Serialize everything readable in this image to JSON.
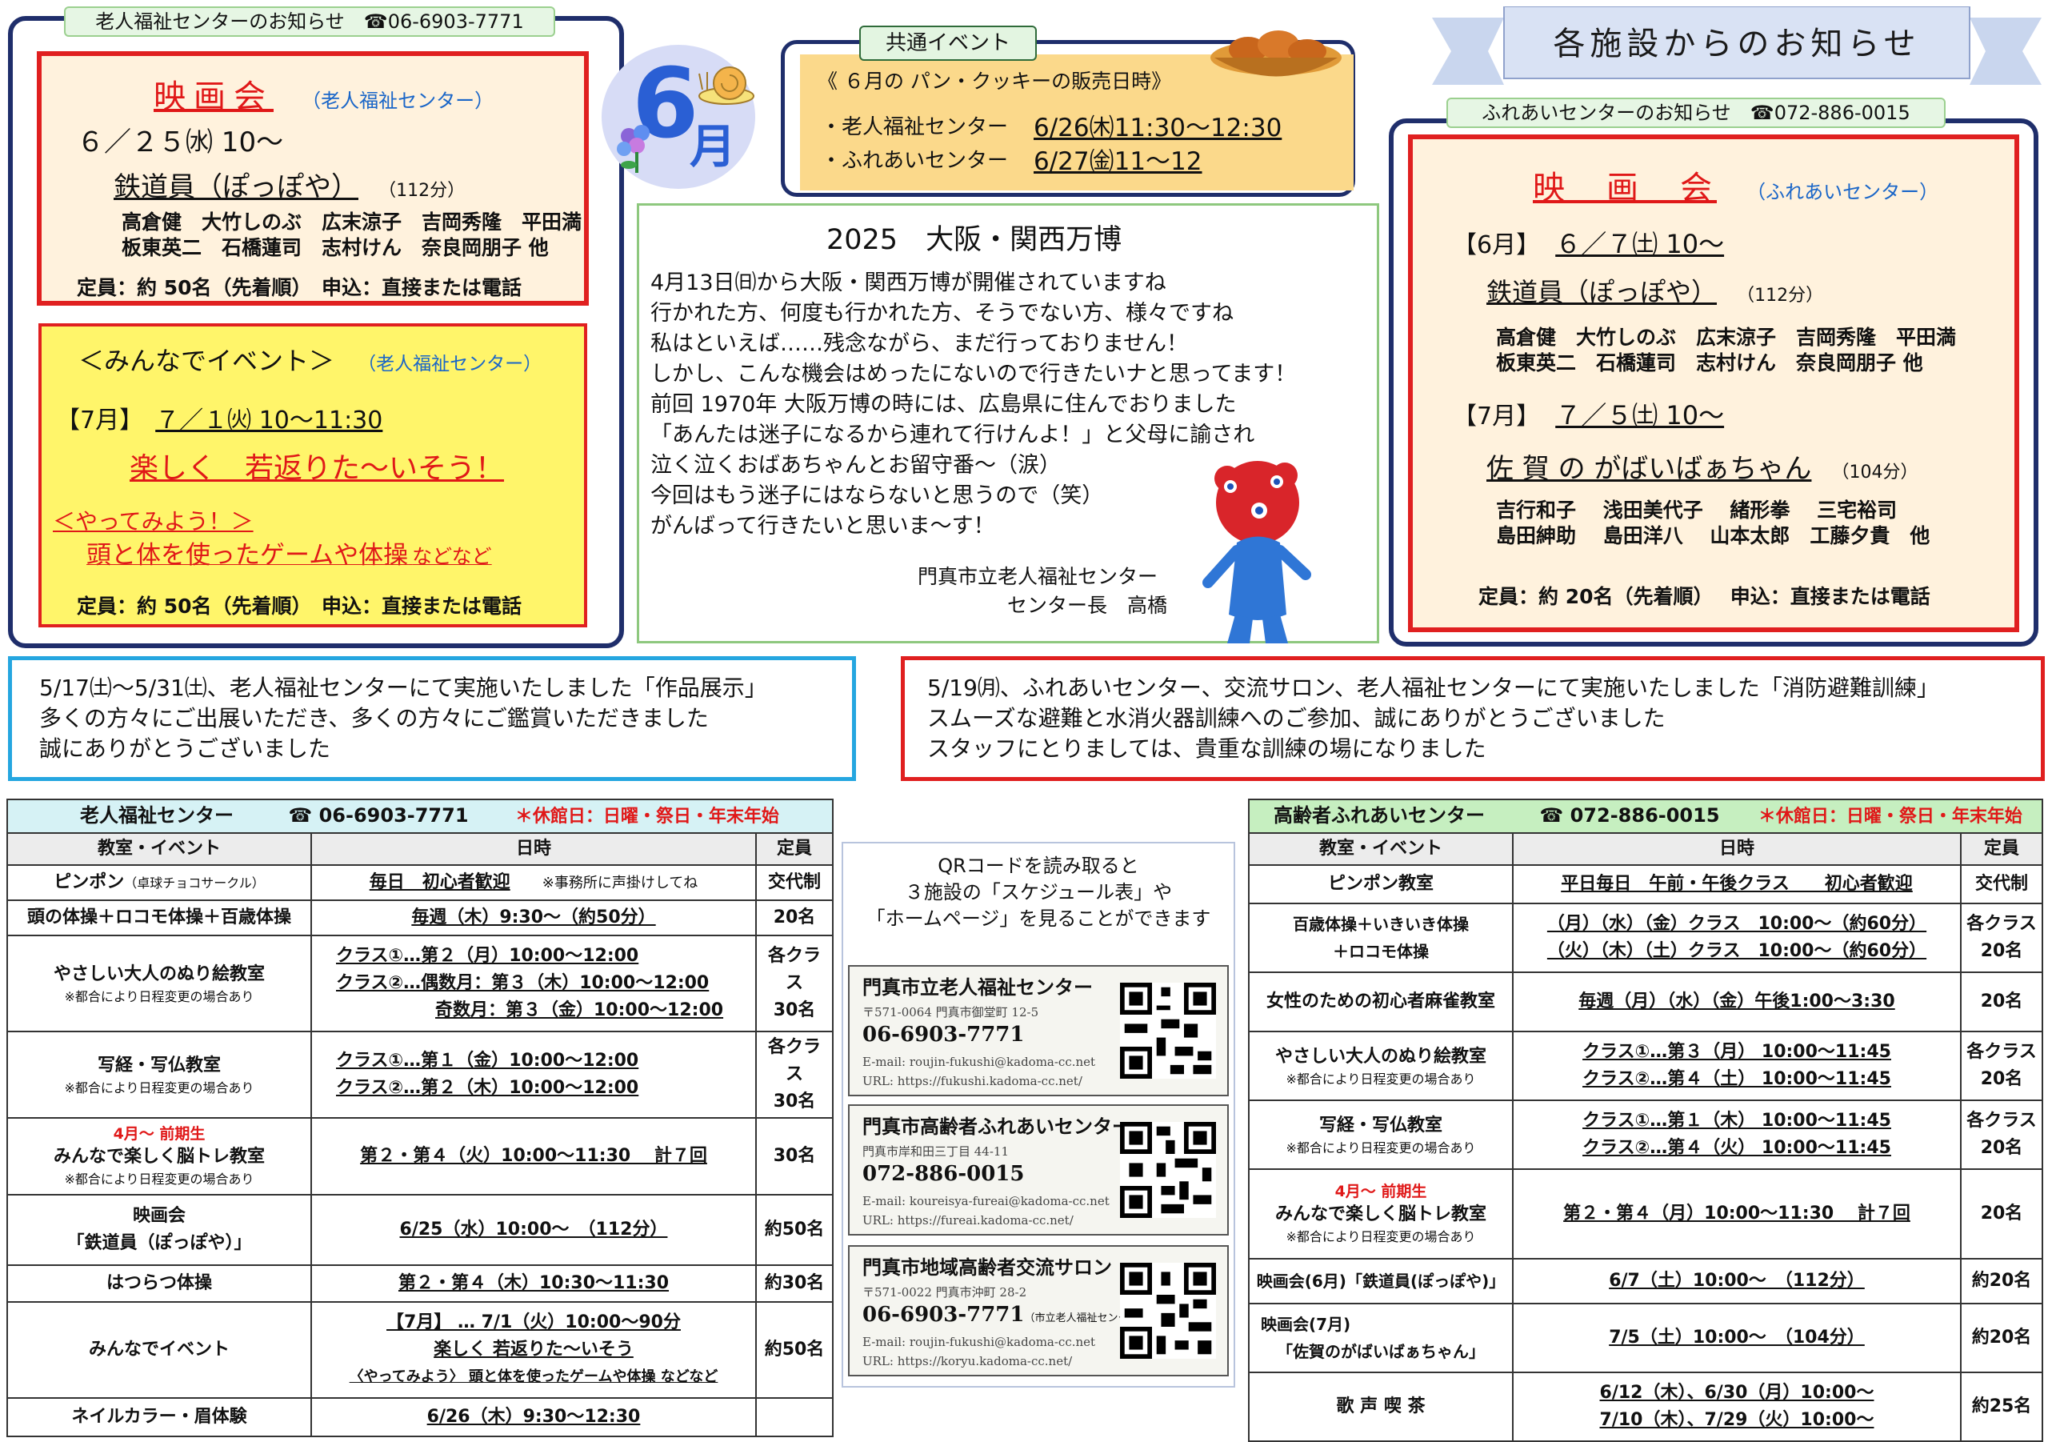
{
  "left_notice": {
    "tab": "老人福祉センターのお知らせ　☎06-6903-7771",
    "movie": {
      "title": "映画会",
      "org": "（老人福祉センター）",
      "date": "６／２５㈬ 10〜",
      "film": "鉄道員（ぽっぽや）",
      "duration": "（112分）",
      "cast1": "高倉健　大竹しのぶ　広末涼子　吉岡秀隆　平田満",
      "cast2": "板東英二　石橋蓮司　志村けん　奈良岡朋子 他",
      "capacity": "定員：約 50名（先着順）　申込：直接または電話"
    },
    "event": {
      "title": "＜みんなでイベント＞",
      "org": "（老人福祉センター）",
      "date_label": "【7月】",
      "date": "７／１㈫ 10〜11:30",
      "headline": "楽しく　若返りた〜いそう！",
      "try": "＜やってみよう！＞",
      "desc": "頭と体を使ったゲームや体操",
      "desc_tail": "などなど",
      "capacity": "定員：約 50名（先着順）　申込：直接または電話"
    }
  },
  "june_badge": {
    "number": "6",
    "suffix": "月"
  },
  "common_event": {
    "tab": "共通イベント",
    "title": "《 ６月の パン・クッキーの販売日時》",
    "row1_label": "・老人福祉センター",
    "row1_value": "6/26㈭11:30〜12:30",
    "row2_label": "・ふれあいセンター",
    "row2_value": "6/27㈮11〜12"
  },
  "expo": {
    "title": "2025　大阪・関西万博",
    "lines": [
      "4月13日㈰から大阪・関西万博が開催されていますね",
      "行かれた方、何度も行かれた方、そうでない方、様々ですね",
      "私はといえば……残念ながら、まだ行っておりません！",
      "しかし、こんな機会はめったにないので行きたいナと思ってます！",
      "前回 1970年 大阪万博の時には、広島県に住んでおりました",
      "「あんたは迷子になるから連れて行けんよ！」と父母に諭され",
      "泣く泣くおばあちゃんとお留守番〜（涙）",
      "今回はもう迷子にはならないと思うので（笑）",
      "がんばって行きたいと思いま〜す！"
    ],
    "sign1": "門真市立老人福祉センター",
    "sign2": "センター長　高橋"
  },
  "right_notice": {
    "banner": "各施設からのお知らせ",
    "tab": "ふれあいセンターのお知らせ　☎072-886-0015",
    "title": "映　画　会",
    "org": "（ふれあいセンター）",
    "m1_label": "【6月】",
    "m1_date": "６／７㈯ 10〜",
    "m1_film": "鉄道員（ぽっぽや）",
    "m1_duration": "（112分）",
    "m1_cast1": "高倉健　大竹しのぶ　広末涼子　吉岡秀隆　平田満",
    "m1_cast2": "板東英二　石橋蓮司　志村けん　奈良岡朋子 他",
    "m2_label": "【7月】",
    "m2_date": "７／５㈯ 10〜",
    "m2_film": "佐 賀 の がばいばぁちゃん",
    "m2_duration": "（104分）",
    "m2_cast1": "吉行和子　 浅田美代子　 緒形拳　 三宅裕司",
    "m2_cast2": "島田紳助　 島田洋八　 山本太郎　工藤夕貴　他",
    "capacity": "定員：約 20名（先着順）　 申込：直接または電話"
  },
  "report_left": [
    "5/17㈯〜5/31㈯、老人福祉センターにて実施いたしました「作品展示」",
    "多くの方々にご出展いただき、多くの方々にご鑑賞いただきました",
    "誠にありがとうございました"
  ],
  "report_right": [
    "5/19㈪、ふれあいセンター、交流サロン、老人福祉センターにて実施いたしました「消防避難訓練」",
    "スムーズな避難と水消火器訓練へのご参加、誠にありがとうございました",
    "スタッフにとりましては、貴重な訓練の場になりました"
  ],
  "left_table": {
    "name": "老人福祉センター",
    "tel": "☎ 06-6903-7771",
    "closed": "＊休館日：日曜・祭日・年末年始",
    "headers": [
      "教室・イベント",
      "日時",
      "定員"
    ],
    "r1": {
      "name": "ピンポン",
      "name_sub": "（卓球チョコサークル）",
      "time": "毎日　初心者歓迎",
      "time_note": "※事務所に声掛けしてね",
      "cap": "交代制"
    },
    "r2": {
      "name": "頭の体操＋ロコモ体操＋百歳体操",
      "time": "毎週（木）9:30〜（約50分）",
      "cap": "20名"
    },
    "r3": {
      "name": "やさしい大人のぬり絵教室",
      "note": "※都合により日程変更の場合あり",
      "t1": "クラス①…第２（月）10:00〜12:00",
      "t2": "クラス②…偶数月：第３（木）10:00〜12:00",
      "t3": "奇数月：第３（金）10:00〜12:00",
      "cap1": "各クラス",
      "cap2": "30名"
    },
    "r4": {
      "name": "写経・写仏教室",
      "note": "※都合により日程変更の場合あり",
      "t1": "クラス①…第１（金）10:00〜12:00",
      "t2": "クラス②…第２（木）10:00〜12:00",
      "cap1": "各クラス",
      "cap2": "30名"
    },
    "r5": {
      "pre": "4月〜 前期生",
      "name": "みんなで楽しく脳トレ教室",
      "note": "※都合により日程変更の場合あり",
      "time": "第２・第４（火）10:00〜11:30　 計７回",
      "cap": "30名"
    },
    "r6": {
      "name": "映画会",
      "name2": "「鉄道員（ぽっぽや）」",
      "time": "6/25（水）10:00〜　（112分）",
      "cap": "約50名"
    },
    "r7": {
      "name": "はつらつ体操",
      "time": "第２・第４（木）10:30〜11:30",
      "cap": "約30名"
    },
    "r8": {
      "name": "みんなでイベント",
      "t1": "【7月】 … 7/1（火）10:00〜90分",
      "t2": "楽しく 若返りた〜いそう",
      "t3": "〈やってみよう〉 頭と体を使ったゲームや体操 などなど",
      "cap": "約50名"
    },
    "r9": {
      "name": "ネイルカラー・眉体験",
      "time": "6/26（木）9:30〜12:30",
      "cap": ""
    }
  },
  "qr_section": {
    "lead1": "QRコードを読み取ると",
    "lead2": "３施設の「スケジュール表」や",
    "lead3": "「ホームページ」を見ることができます",
    "cards": [
      {
        "name": "門真市立老人福祉センター",
        "addr": "〒571-0064 門真市御堂町 12-5",
        "tel": "06-6903-7771",
        "email": "E-mail: roujin-fukushi@kadoma-cc.net",
        "url": "URL: https://fukushi.kadoma-cc.net/"
      },
      {
        "name": "門真市高齢者ふれあいセンター",
        "addr": "門真市岸和田三丁目 44-11",
        "tel": "072-886-0015",
        "email": "E-mail: koureisya-fureai@kadoma-cc.net",
        "url": "URL: https://fureai.kadoma-cc.net/"
      },
      {
        "name": "門真市地域高齢者交流サロン",
        "addr": "〒571-0022 門真市沖町 28-2",
        "tel": "06-6903-7771",
        "tel_note": "（市立老人福祉センター）",
        "email": "E-mail: roujin-fukushi@kadoma-cc.net",
        "url": "URL: https://koryu.kadoma-cc.net/"
      }
    ]
  },
  "right_table": {
    "name": "高齢者ふれあいセンター",
    "tel": "☎ 072-886-0015",
    "closed": "＊休館日：日曜・祭日・年末年始",
    "headers": [
      "教室・イベント",
      "日時",
      "定員"
    ],
    "r1": {
      "name": "ピンポン教室",
      "time": "平日毎日　午前・午後クラス　　初心者歓迎",
      "cap": "交代制"
    },
    "r2": {
      "name": "百歳体操＋いきいき体操",
      "name2": "＋ロコモ体操",
      "t1": "（月）（水）（金）クラス　10:00〜（約60分）",
      "t2": "（火）（木）（土）クラス　10:00〜（約60分）",
      "cap1": "各クラス",
      "cap2": "20名"
    },
    "r3": {
      "name": "女性のための初心者麻雀教室",
      "time": "毎週（月）（水）（金）午後1:00〜3:30",
      "cap": "20名"
    },
    "r4": {
      "name": "やさしい大人のぬり絵教室",
      "note": "※都合により日程変更の場合あり",
      "t1": "クラス①…第３（月） 10:00〜11:45",
      "t2": "クラス②…第４（土） 10:00〜11:45",
      "cap1": "各クラス",
      "cap2": "20名"
    },
    "r5": {
      "name": "写経・写仏教室",
      "note": "※都合により日程変更の場合あり",
      "t1": "クラス①…第１（木） 10:00〜11:45",
      "t2": "クラス②…第４（火） 10:00〜11:45",
      "cap1": "各クラス",
      "cap2": "20名"
    },
    "r6": {
      "pre": "4月〜 前期生",
      "name": "みんなで楽しく脳トレ教室",
      "note": "※都合により日程変更の場合あり",
      "time": "第２・第４（月）10:00〜11:30　 計７回",
      "cap": "20名"
    },
    "r7": {
      "name": "映画会(6月)「鉄道員(ぽっぽや)」",
      "time": "6/7（土）10:00〜　（112分）",
      "cap": "約20名"
    },
    "r8": {
      "name": "映画会(7月)",
      "name2": "「佐賀のがばいばぁちゃん」",
      "time": "7/5（土）10:00〜　（104分）",
      "cap": "約20名"
    },
    "r9": {
      "name": "歌 声 喫 茶",
      "t1": "6/12（木）、6/30（月）10:00〜",
      "t2": "7/10（木）、7/29（火）10:00〜",
      "cap": "約25名"
    }
  }
}
